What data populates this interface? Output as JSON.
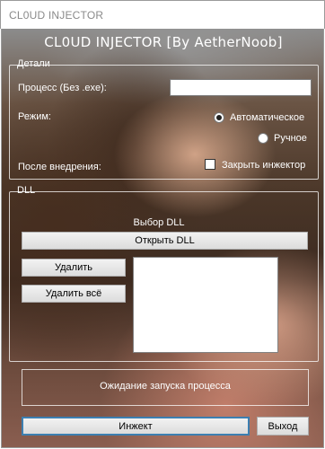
{
  "window": {
    "title": "CL0UD INJECTOR"
  },
  "header": {
    "title": "CL0UD INJECTOR [By AetherNoob]"
  },
  "details": {
    "legend": "Детали",
    "process_label": "Процесс (Без .exe):",
    "process_value": "",
    "mode_label": "Режим:",
    "mode_auto": "Автоматическое",
    "mode_manual": "Ручное",
    "selected_mode": "auto",
    "after_inject_label": "После внедрения:",
    "close_injector_label": "Закрыть инжектор",
    "close_injector_checked": false
  },
  "dll": {
    "legend": "DLL",
    "select_label": "Выбор DLL",
    "open_button": "Открыть DLL",
    "delete_button": "Удалить",
    "delete_all_button": "Удалить всё",
    "items": []
  },
  "status": {
    "text": "Ожидание запуска процесса"
  },
  "footer": {
    "inject_button": "Инжект",
    "exit_button": "Выход"
  }
}
